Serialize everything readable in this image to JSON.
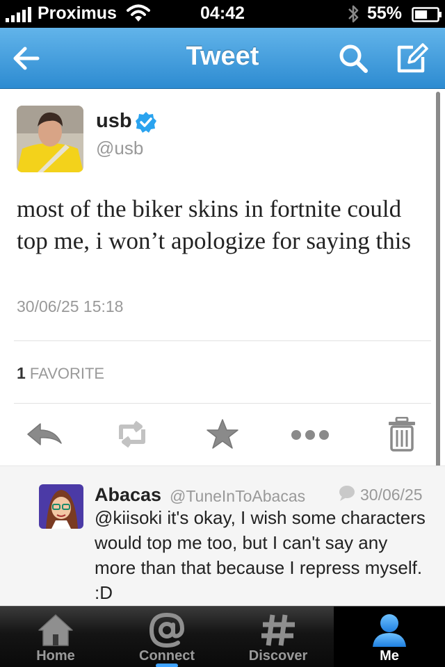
{
  "status_bar": {
    "carrier": "Proximus",
    "time": "04:42",
    "battery_percent": "55%",
    "battery_level": 0.55
  },
  "nav": {
    "title": "Tweet",
    "icons": [
      "back-arrow-icon",
      "search-icon",
      "compose-icon"
    ]
  },
  "tweet": {
    "user_name": "usb",
    "handle": "@usb",
    "verified": true,
    "text": "most of the biker skins in fortnite could top me, i won’t apologize for saying this",
    "timestamp": "30/06/25 15:18",
    "favorite_count": "1",
    "favorite_label": "FAVORITE",
    "actions": [
      "reply-icon",
      "retweet-icon",
      "favorite-star-icon",
      "more-dots-icon",
      "trash-icon"
    ]
  },
  "reply": {
    "user_name": "Abacas",
    "handle": "@TuneInToAbacas",
    "date": "30/06/25",
    "text": "@kiisoki it's okay, I wish some characters would top me too, but I can't say any more than that because I repress myself. :D"
  },
  "tab_bar": {
    "tabs": [
      {
        "label": "Home",
        "icon": "home-icon"
      },
      {
        "label": "Connect",
        "icon": "at-sign-icon"
      },
      {
        "label": "Discover",
        "icon": "hashtag-icon"
      },
      {
        "label": "Me",
        "icon": "person-icon"
      }
    ],
    "active": "Me"
  },
  "colors": {
    "nav_blue_top": "#62b4ea",
    "nav_blue_bottom": "#2d8bd1",
    "verified_blue": "#2aa3ef",
    "me_tab_blue": "#3fa3ff"
  }
}
